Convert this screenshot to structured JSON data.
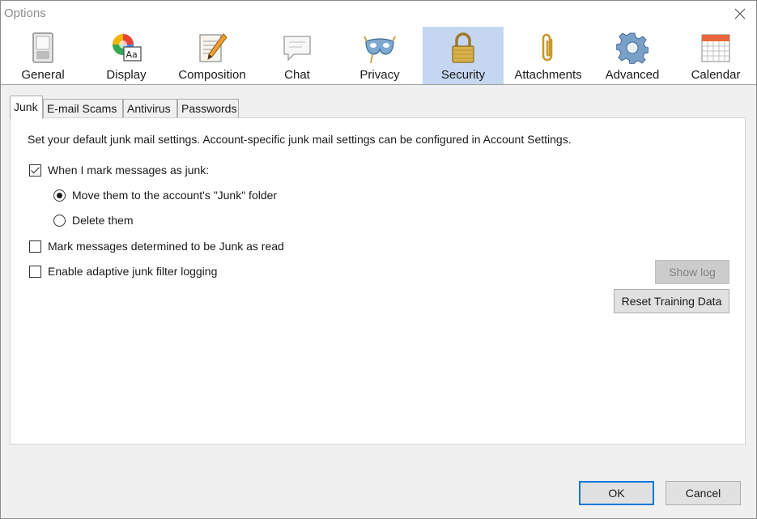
{
  "window": {
    "title": "Options"
  },
  "panes": [
    {
      "id": "general",
      "label": "General",
      "icon": "switch-icon",
      "selected": false
    },
    {
      "id": "display",
      "label": "Display",
      "icon": "color-wheel-font-icon",
      "selected": false
    },
    {
      "id": "composition",
      "label": "Composition",
      "icon": "notepad-pencil-icon",
      "selected": false
    },
    {
      "id": "chat",
      "label": "Chat",
      "icon": "speech-bubble-icon",
      "selected": false
    },
    {
      "id": "privacy",
      "label": "Privacy",
      "icon": "mask-icon",
      "selected": false
    },
    {
      "id": "security",
      "label": "Security",
      "icon": "padlock-icon",
      "selected": true
    },
    {
      "id": "attachments",
      "label": "Attachments",
      "icon": "paperclip-icon",
      "selected": false
    },
    {
      "id": "advanced",
      "label": "Advanced",
      "icon": "gear-icon",
      "selected": false
    },
    {
      "id": "calendar",
      "label": "Calendar",
      "icon": "calendar-icon",
      "selected": false
    }
  ],
  "tabs": [
    {
      "label": "Junk",
      "active": true
    },
    {
      "label": "E-mail Scams",
      "active": false
    },
    {
      "label": "Antivirus",
      "active": false
    },
    {
      "label": "Passwords",
      "active": false
    }
  ],
  "junk": {
    "description": "Set your default junk mail settings. Account-specific junk mail settings can be configured in Account Settings.",
    "mark_as_junk": {
      "label": "When I mark messages as junk:",
      "checked": true
    },
    "move_option": {
      "label": "Move them to the account's \"Junk\" folder",
      "checked": true
    },
    "delete_option": {
      "label": "Delete them",
      "checked": false
    },
    "mark_read": {
      "label": "Mark messages determined to be Junk as read",
      "checked": false
    },
    "adaptive_logging": {
      "label": "Enable adaptive junk filter logging",
      "checked": false
    },
    "show_log_label": "Show log",
    "reset_training_label": "Reset Training Data"
  },
  "footer": {
    "ok_label": "OK",
    "cancel_label": "Cancel"
  },
  "colors": {
    "selected_pane": "#c4d6f0",
    "default_button_border": "#0078d7"
  }
}
